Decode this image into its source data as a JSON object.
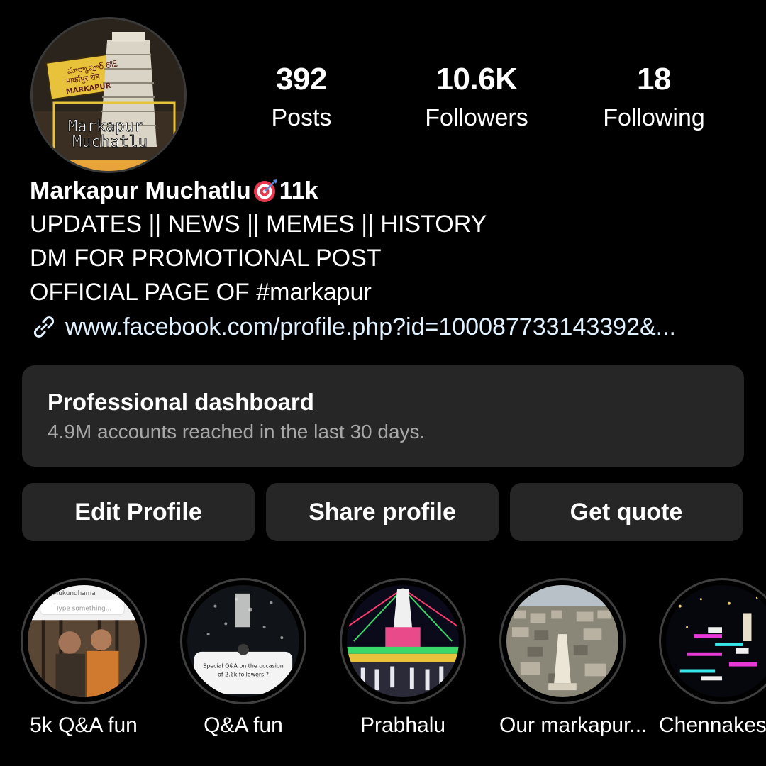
{
  "profile": {
    "avatar_text": [
      "మార్కాపూర్ రోడ్",
      "मार्कापुर रोड",
      "MARKAPUR",
      "Markapur",
      "Muchatlu"
    ],
    "avatar_icon": "temple-gopuram-avatar"
  },
  "stats": {
    "posts": {
      "value": "392",
      "label": "Posts"
    },
    "followers": {
      "value": "10.6K",
      "label": "Followers"
    },
    "following": {
      "value": "18",
      "label": "Following"
    }
  },
  "bio": {
    "name": "Markapur Muchatlu",
    "name_emoji_icon": "target-dart-icon",
    "name_suffix": "11k",
    "lines": [
      "UPDATES || NEWS || MEMES || HISTORY",
      "DM FOR PROMOTIONAL POST",
      "OFFICIAL PAGE OF #markapur"
    ],
    "link_icon": "link-icon",
    "link": "www.facebook.com/profile.php?id=100087733143392&..."
  },
  "dashboard": {
    "title": "Professional dashboard",
    "subtitle": "4.9M accounts reached in the last 30 days."
  },
  "buttons": {
    "edit": "Edit Profile",
    "share": "Share profile",
    "quote": "Get quote"
  },
  "highlights": [
    {
      "label": "5k Q&A fun",
      "pic_text": [
        "Type something...",
        "Mukundhama"
      ]
    },
    {
      "label": "Q&A fun",
      "pic_text": [
        "Special Q&A on the occasion",
        "of 2.6k followers ?"
      ]
    },
    {
      "label": "Prabhalu"
    },
    {
      "label": "Our markapur..."
    },
    {
      "label": "Chennakesh"
    }
  ],
  "colors": {
    "background": "#000000",
    "surface": "#262626",
    "secondary_text": "#a8a8a8",
    "link_text": "#e0f1ff"
  }
}
